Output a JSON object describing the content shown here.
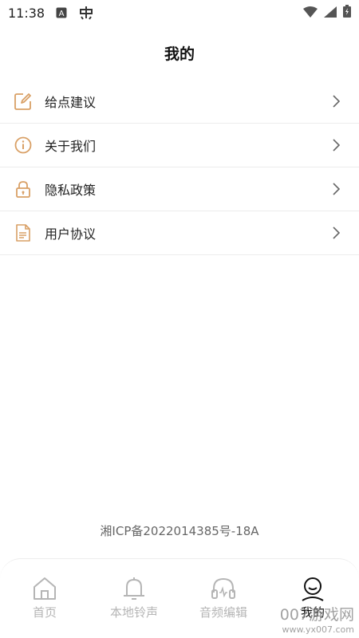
{
  "status_bar": {
    "time": "11:38",
    "icons": [
      "a-icon",
      "notification-app-icon",
      "wifi-icon",
      "signal-icon",
      "battery-charging-icon"
    ]
  },
  "header": {
    "title": "我的"
  },
  "menu": {
    "items": [
      {
        "label": "给点建议",
        "icon": "edit-icon"
      },
      {
        "label": "关于我们",
        "icon": "info-icon"
      },
      {
        "label": "隐私政策",
        "icon": "lock-icon"
      },
      {
        "label": "用户协议",
        "icon": "document-icon"
      }
    ]
  },
  "footer": {
    "icp": "湘ICP备2022014385号-18A"
  },
  "tab_bar": {
    "tabs": [
      {
        "label": "首页",
        "icon": "home-icon"
      },
      {
        "label": "本地铃声",
        "icon": "bell-icon"
      },
      {
        "label": "音频编辑",
        "icon": "headphones-icon"
      },
      {
        "label": "我的",
        "icon": "profile-icon",
        "active": true
      }
    ]
  },
  "watermark": {
    "main": "007游戏网",
    "url": "www.yx007.com"
  },
  "colors": {
    "accent": "#d9a066",
    "text": "#222222",
    "muted": "#b5b5b5"
  }
}
